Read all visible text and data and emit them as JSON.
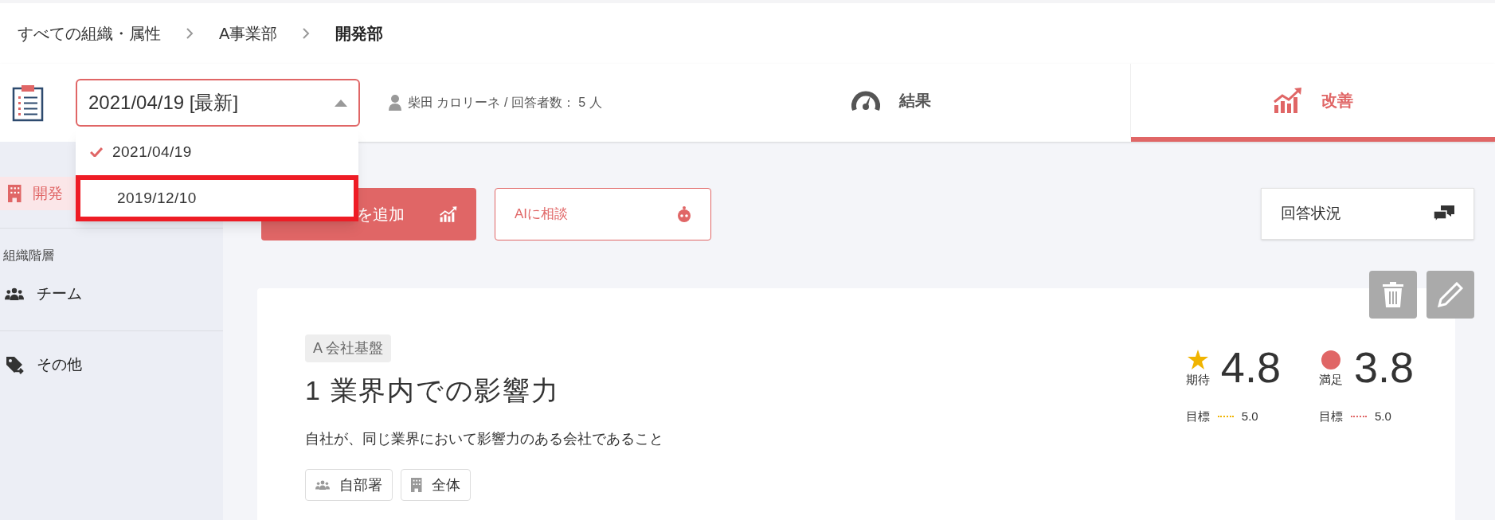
{
  "breadcrumbs": [
    {
      "label": "すべての組織・属性",
      "current": false
    },
    {
      "label": "A事業部",
      "current": false
    },
    {
      "label": "開発部",
      "current": true
    }
  ],
  "survey_select": {
    "value": "2021/04/19 [最新]",
    "expanded": true,
    "options": [
      {
        "label": "2021/04/19",
        "selected": true,
        "highlighted": false
      },
      {
        "label": "2019/12/10",
        "selected": false,
        "highlighted": true
      }
    ]
  },
  "respondent": "柴田 カロリーネ / 回答者数： 5 人",
  "tabs": [
    {
      "label": "結果",
      "kind": "gauge",
      "selected": false
    },
    {
      "label": "改善",
      "kind": "chart",
      "selected": true
    }
  ],
  "sidebar": {
    "current": {
      "label": "開発",
      "selected": true
    },
    "sections": [
      {
        "heading": "組織階層",
        "items": [
          {
            "label": "チーム",
            "kind": "team"
          }
        ]
      },
      {
        "items": [
          {
            "label": "その他",
            "kind": "tag"
          }
        ]
      }
    ]
  },
  "actions": {
    "add_button": "を追加",
    "ai_button": "AIに相談",
    "status_button": "回答状況"
  },
  "card": {
    "tag": "A 会社基盤",
    "title": "1 業界内での影響力",
    "description": "自社が、同じ業界において影響力のある会社であること",
    "scopes": [
      {
        "label": "自部署",
        "kind": "team"
      },
      {
        "label": "全体",
        "kind": "building"
      }
    ],
    "scores": [
      {
        "kind": "star",
        "color": "#f0b400",
        "label": "期待",
        "value": "4.8",
        "target_label": "目標",
        "target": "5.0"
      },
      {
        "kind": "dot",
        "color": "#e06666",
        "label": "満足",
        "value": "3.8",
        "target_label": "目標",
        "target": "5.0"
      }
    ]
  }
}
